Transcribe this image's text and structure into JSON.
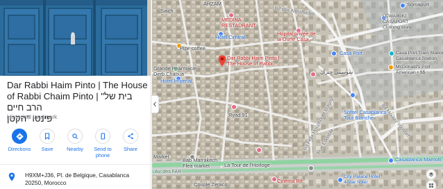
{
  "place": {
    "title_en": "Dar Rabbi Haim Pinto | The House of Rabbi Chaim Pinto | \"בית של הרב חיים",
    "title_he": "פינטו \"הקטן",
    "category": "Historical landmark",
    "address": "H9XM+J36, Pl. de Belgique, Casablanca 20250, Morocco"
  },
  "actions": [
    {
      "label": "Directions",
      "icon": "directions-icon"
    },
    {
      "label": "Save",
      "icon": "bookmark-icon"
    },
    {
      "label": "Nearby",
      "icon": "nearby-icon"
    },
    {
      "label": "Send to phone",
      "icon": "send-to-phone-icon"
    },
    {
      "label": "Share",
      "icon": "share-icon"
    }
  ],
  "map": {
    "labels": {
      "ahzam": "AHZAM",
      "saich": "Saich",
      "medina_restaurant": "MEDINA\nRESTAURANT",
      "bd_almohades": "Bd des Almohades",
      "hotel_central": "Hôtel Central",
      "hopital": "Hopital privée de\nla Ourfe Casa",
      "pipe_coffee": "Pipe coffee",
      "rabbi_marker": "Dar Rabbi Haim Pinto |\nThe House of Rabbi ...",
      "grande_pharmacie": "Grande Pharmacie\nDerb Chaoua",
      "hotel_imperial": "Hotel Imperial",
      "ryad": "Ryad 91",
      "sofitel": "Sofitel Casablanca\nTour Blanche",
      "market": "Market",
      "bab_marrakech": "Bab Marrakech\nFlea market",
      "tour_horloge": "La Tour de l'Horloge",
      "av_far": "Av. des FAR",
      "cinema_rif": "Cinema Rif",
      "couple_zeraco": "Couple Zeraco",
      "casa_port": "Casa Port",
      "casa_port_station": "Casa Port Train Station\nCasablanca Station",
      "mcdonalds": "McDonald's Port\nAmerican • $$",
      "lcwaikiki": "LCWAIKIKI\nCASAPORT\nClothing store",
      "somapurt": "Somapurt",
      "marriott": "Casablanca Marriott",
      "city_palace": "City Palace Hotel\n4-star hotel",
      "bd_moulay": "Bd Moulay Youssef",
      "arabic_sign": "سوسيتي جنرال",
      "bd_felix": "Bd Félix Houphouet Boigny",
      "rue_eddabla": "Rue Eddabla"
    }
  },
  "colors": {
    "accent": "#1a73e8",
    "marker": "#ea4335",
    "primary_road": "#8fd3a1",
    "secondary_road": "#f5f5f5"
  }
}
